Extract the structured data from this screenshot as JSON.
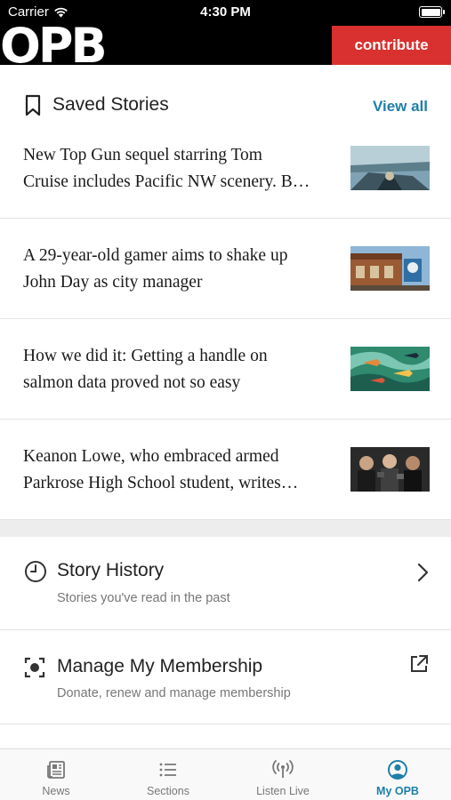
{
  "status_bar": {
    "carrier": "Carrier",
    "time": "4:30 PM"
  },
  "header": {
    "logo": "OPB",
    "contribute_label": "contribute"
  },
  "saved": {
    "title": "Saved Stories",
    "view_all": "View all",
    "stories": [
      {
        "line1": "New Top Gun sequel starring Tom",
        "line2": "Cruise includes Pacific NW scenery. B…"
      },
      {
        "line1": "A 29-year-old gamer aims to shake up",
        "line2": "John Day as city manager"
      },
      {
        "line1": "How we did it: Getting a handle on",
        "line2": "salmon data proved not so easy"
      },
      {
        "line1": "Keanon Lowe, who embraced armed",
        "line2": "Parkrose High School student, writes…"
      }
    ]
  },
  "menu": {
    "history": {
      "label": "Story History",
      "sub": "Stories you've read in the past"
    },
    "membership": {
      "label": "Manage My Membership",
      "sub": "Donate, renew and manage membership"
    }
  },
  "tabs": [
    {
      "label": "News",
      "icon": "news-icon"
    },
    {
      "label": "Sections",
      "icon": "sections-icon"
    },
    {
      "label": "Listen Live",
      "icon": "broadcast-icon"
    },
    {
      "label": "My OPB",
      "icon": "profile-icon"
    }
  ],
  "colors": {
    "accent": "#1f7fa8",
    "contribute": "#d8312f",
    "header": "#000000"
  }
}
